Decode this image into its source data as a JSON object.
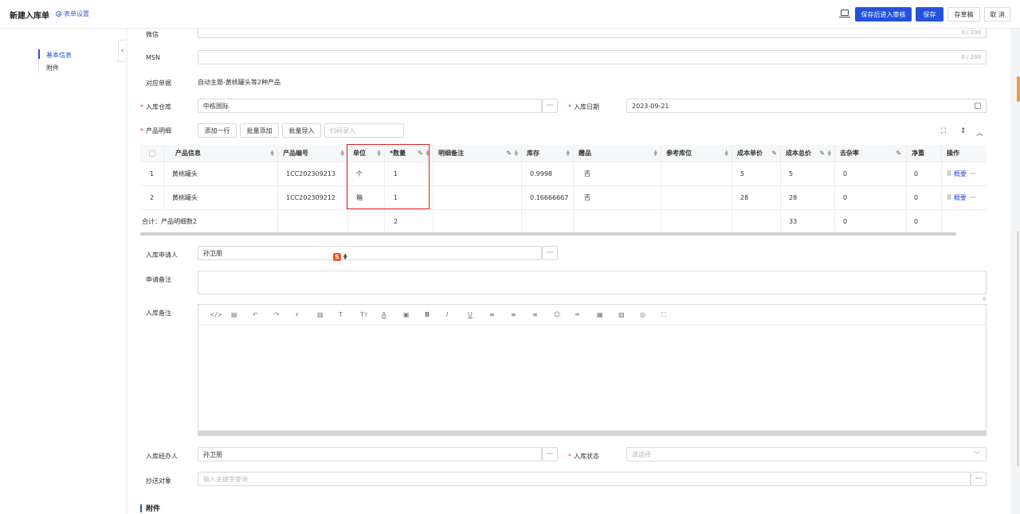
{
  "header": {
    "title": "新建入库单",
    "form_settings": "表单设置",
    "buttons": {
      "save_submit": "保存后进入审核",
      "save": "保存",
      "draft": "存草稿",
      "cancel": "取 消"
    }
  },
  "sidenav": {
    "items": [
      {
        "label": "基本信息",
        "active": true
      },
      {
        "label": "附件",
        "active": false
      }
    ]
  },
  "form": {
    "wechat": {
      "label": "微信",
      "counter": "0 / 200"
    },
    "msn": {
      "label": "MSN",
      "counter": "0 / 200"
    },
    "related_doc": {
      "label": "对应单据",
      "value": "自动主题-黄桃罐头等2种产品"
    },
    "warehouse": {
      "label": "入库仓库",
      "value": "中栋国际"
    },
    "date": {
      "label": "入库日期",
      "value": "2023-09-21"
    },
    "products": {
      "label": "产品明细",
      "add_row": "添加一行",
      "batch_add": "批量添加",
      "batch_import": "批量导入",
      "scan_placeholder": "扫码录入"
    },
    "applicant": {
      "label": "入库申请人",
      "value": "孙卫朋"
    },
    "apply_note": {
      "label": "申请备注",
      "counter": "0"
    },
    "stock_note": {
      "label": "入库备注"
    },
    "handler": {
      "label": "入库经办人",
      "value": "孙卫朋"
    },
    "status": {
      "label": "入库状态",
      "placeholder": "请选择"
    },
    "cc": {
      "label": "抄送对象",
      "placeholder": "输入关键字查询"
    }
  },
  "table": {
    "headers": {
      "product_info": "产品信息",
      "product_code": "产品编号",
      "unit": "单位",
      "quantity": "*数量",
      "detail_note": "明细备注",
      "stock": "库存",
      "gift": "赠品",
      "ref_location": "参考库位",
      "unit_cost": "成本单价",
      "total_cost": "成本总价",
      "impurity": "去杂率",
      "net_weight": "净重",
      "action": "操作"
    },
    "rows": [
      {
        "no": "1",
        "product": "黄桃罐头",
        "code": "1CC202309213",
        "unit": "个",
        "qty": "1",
        "stock": "0.9998",
        "gift": "否",
        "unit_cost": "5",
        "total_cost": "5",
        "impurity": "0",
        "net": "0",
        "action": "概要"
      },
      {
        "no": "2",
        "product": "黄桃罐头",
        "code": "1CC202309212",
        "unit": "箱",
        "qty": "1",
        "stock": "0.16666667",
        "gift": "否",
        "unit_cost": "28",
        "total_cost": "28",
        "impurity": "0",
        "net": "0",
        "action": "概要"
      }
    ],
    "summary": {
      "label": "合计：产品明细数2",
      "qty": "2",
      "total_cost": "33",
      "impurity": "0",
      "net": "0"
    }
  },
  "section": {
    "attachments": "附件"
  },
  "colors": {
    "primary": "#2452e0",
    "highlight": "#e02020",
    "required": "#e33"
  }
}
